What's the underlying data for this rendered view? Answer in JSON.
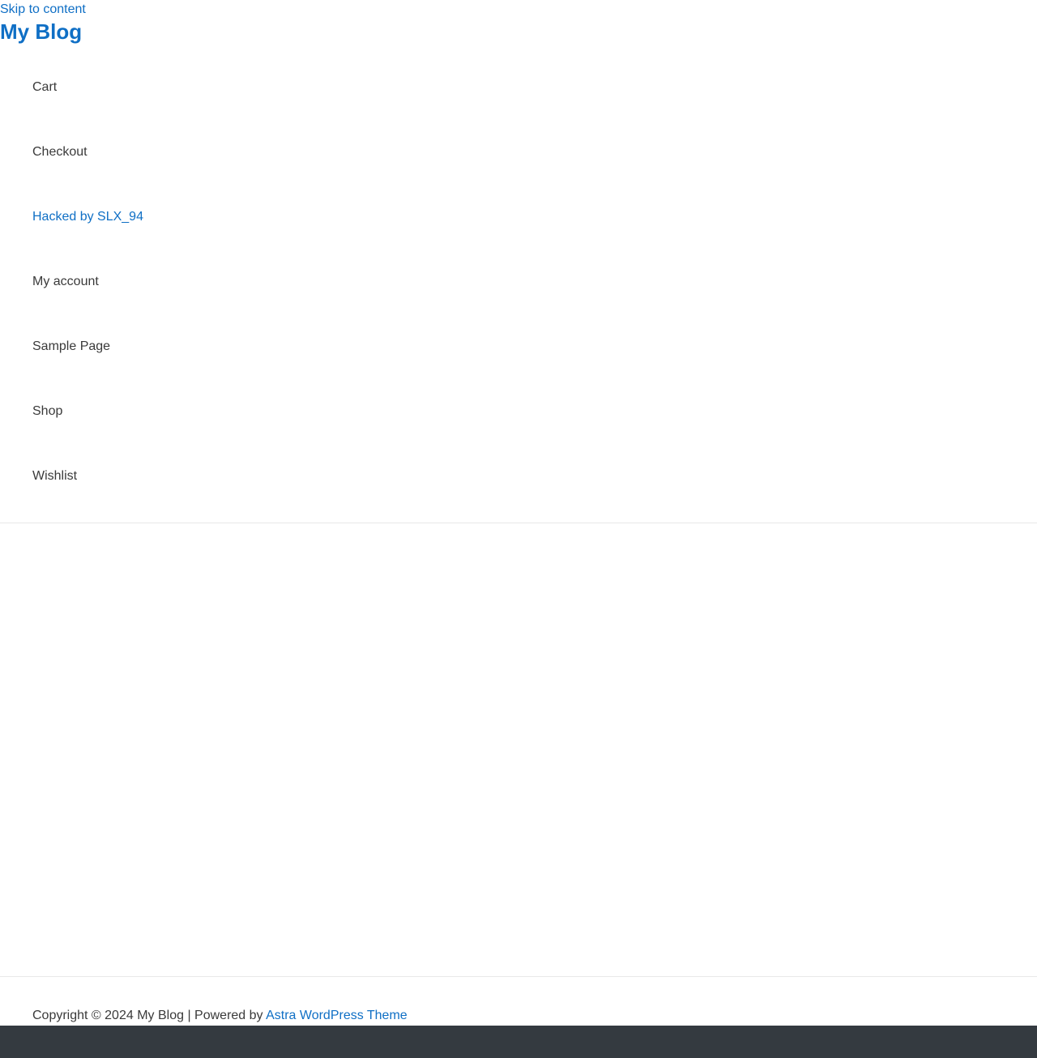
{
  "header": {
    "skip_link": "Skip to content",
    "site_title": "My Blog"
  },
  "nav": {
    "items": [
      {
        "label": "Cart"
      },
      {
        "label": "Checkout"
      },
      {
        "label": "Hacked by SLX_94",
        "current": true
      },
      {
        "label": "My account"
      },
      {
        "label": "Sample Page"
      },
      {
        "label": "Shop"
      },
      {
        "label": "Wishlist"
      }
    ]
  },
  "footer": {
    "copyright": "Copyright © 2024 My Blog | Powered by ",
    "theme_link": "Astra WordPress Theme"
  },
  "colors": {
    "link": "#0f6fc5",
    "text": "#3a3a3a",
    "admin_bar": "#343a40",
    "divider": "#e8e8e8"
  }
}
